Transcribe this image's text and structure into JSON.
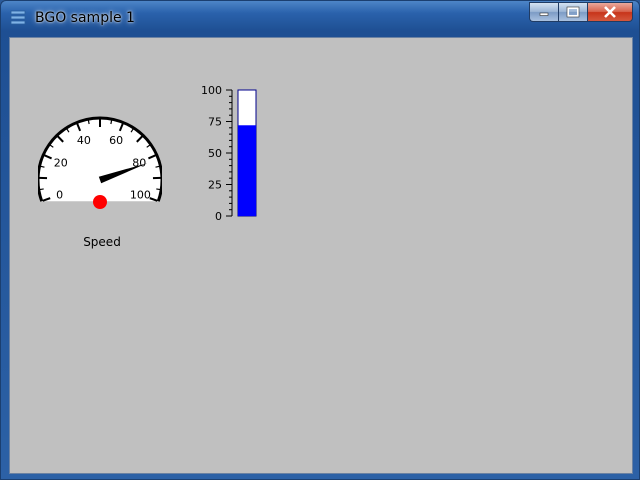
{
  "window": {
    "title": "BGO sample 1"
  },
  "gauge": {
    "label": "Speed",
    "ticks": [
      "0",
      "20",
      "40",
      "60",
      "80",
      "100"
    ],
    "value": 82,
    "min": 0,
    "max": 100
  },
  "bar_gauge": {
    "ticks": [
      "100",
      "75",
      "50",
      "25",
      "0"
    ],
    "value": 72,
    "min": 0,
    "max": 100,
    "fill_color": "#0000ff"
  },
  "colors": {
    "client_background": "#c0c0c0",
    "indicator_dot": "#ff0000",
    "needle": "#000000"
  }
}
